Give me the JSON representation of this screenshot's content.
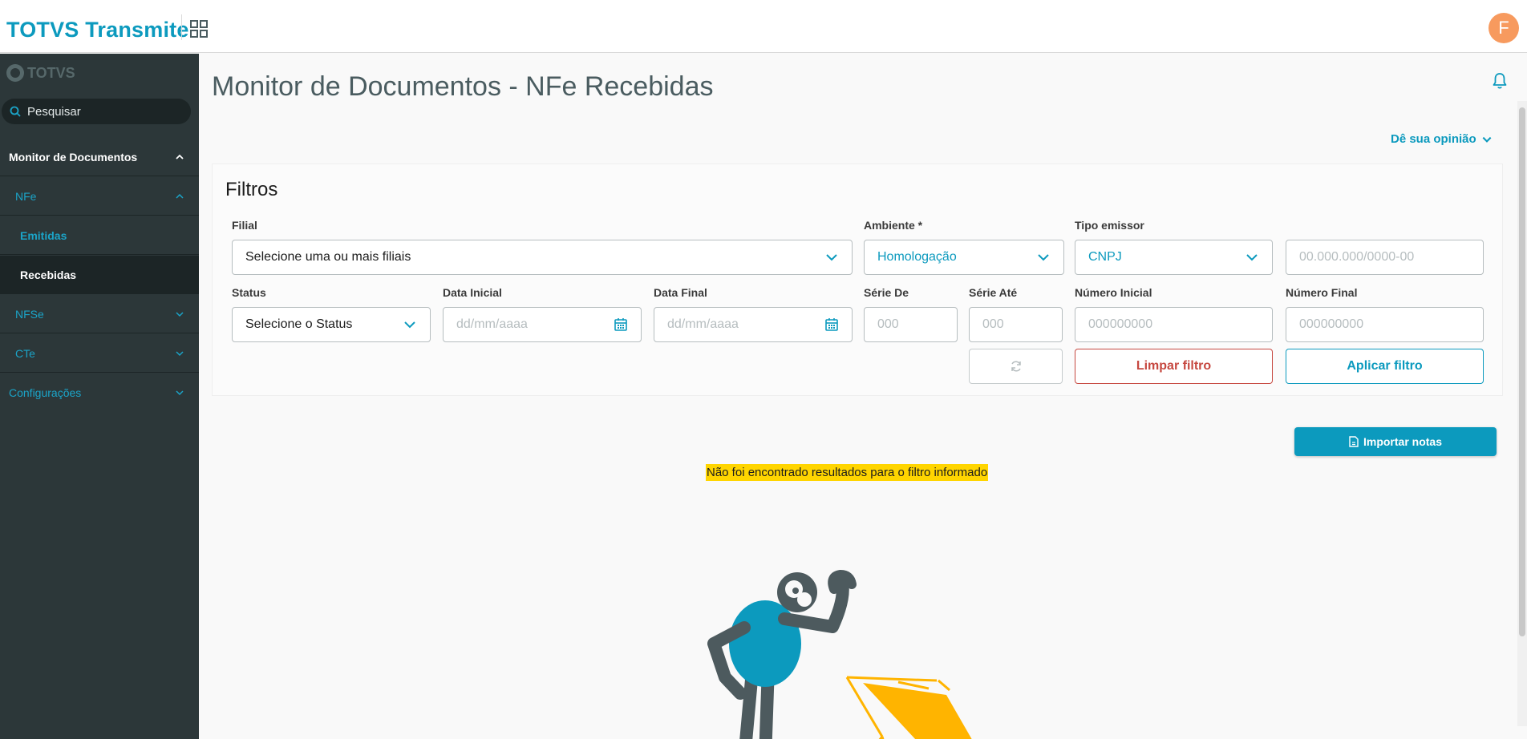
{
  "app": {
    "title": "TOTVS Transmite",
    "avatar_letter": "F",
    "brand_color": "#0c9abe"
  },
  "sidebar": {
    "logo_text": "TOTVS",
    "search_placeholder": "Pesquisar",
    "items": [
      {
        "label": "Monitor de Documentos",
        "expanded": true
      },
      {
        "label": "NFe",
        "expanded": true
      },
      {
        "label": "Emitidas"
      },
      {
        "label": "Recebidas",
        "active": true
      },
      {
        "label": "NFSe",
        "expanded": false
      },
      {
        "label": "CTe",
        "expanded": false
      },
      {
        "label": "Configurações",
        "expanded": false
      }
    ]
  },
  "page": {
    "title": "Monitor de Documentos - NFe Recebidas",
    "feedback": "Dê sua opinião"
  },
  "filters": {
    "title": "Filtros",
    "filial": {
      "label": "Filial",
      "value": "Selecione uma ou mais filiais"
    },
    "ambiente": {
      "label": "Ambiente *",
      "value": "Homologação"
    },
    "tipo_emissor": {
      "label": "Tipo emissor",
      "value": "CNPJ"
    },
    "documento": {
      "placeholder": "00.000.000/0000-00"
    },
    "status": {
      "label": "Status",
      "value": "Selecione o Status"
    },
    "data_inicial": {
      "label": "Data Inicial",
      "placeholder": "dd/mm/aaaa"
    },
    "data_final": {
      "label": "Data Final",
      "placeholder": "dd/mm/aaaa"
    },
    "serie_de": {
      "label": "Série De",
      "placeholder": "000"
    },
    "serie_ate": {
      "label": "Série Até",
      "placeholder": "000"
    },
    "numero_inicial": {
      "label": "Número Inicial",
      "placeholder": "000000000"
    },
    "numero_final": {
      "label": "Número Final",
      "placeholder": "000000000"
    },
    "clear_label": "Limpar filtro",
    "apply_label": "Aplicar filtro"
  },
  "actions": {
    "import_label": "Importar notas"
  },
  "empty_state": {
    "message": "Não foi encontrado resultados para o filtro informado",
    "highlight_color": "#ffd500"
  },
  "icons": {
    "apps": "grid-icon",
    "search": "search-icon",
    "bell": "bell-icon",
    "calendar": "calendar-icon",
    "refresh": "refresh-icon",
    "document": "document-icon"
  }
}
